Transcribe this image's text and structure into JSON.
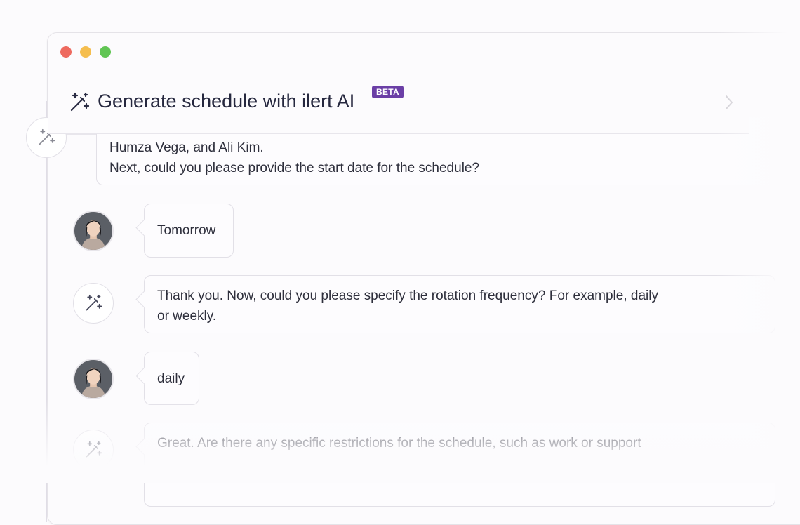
{
  "window": {
    "title": "Generate schedule with ilert AI",
    "badge": "BETA"
  },
  "messages": [
    {
      "role": "assistant",
      "avatar_icon": "magic-wand-icon",
      "lines": [
        "Humza Vega, and Ali Kim.",
        "Next, could you please provide the start date for the schedule?"
      ]
    },
    {
      "role": "user",
      "avatar_icon": "user-photo",
      "lines": [
        "Tomorrow"
      ]
    },
    {
      "role": "assistant",
      "avatar_icon": "magic-wand-icon",
      "lines": [
        "Thank you. Now, could you please specify the rotation frequency? For example, daily",
        "or weekly."
      ]
    },
    {
      "role": "user",
      "avatar_icon": "user-photo",
      "lines": [
        "daily"
      ]
    },
    {
      "role": "assistant",
      "avatar_icon": "magic-wand-icon",
      "lines": [
        "Great. Are there any specific restrictions for the schedule, such as work or support"
      ]
    }
  ],
  "colors": {
    "title": "#26283f",
    "badge_bg": "#6b3fa6",
    "traffic_red": "#ee6a5f",
    "traffic_yellow": "#f5be4f",
    "traffic_green": "#61c554"
  }
}
